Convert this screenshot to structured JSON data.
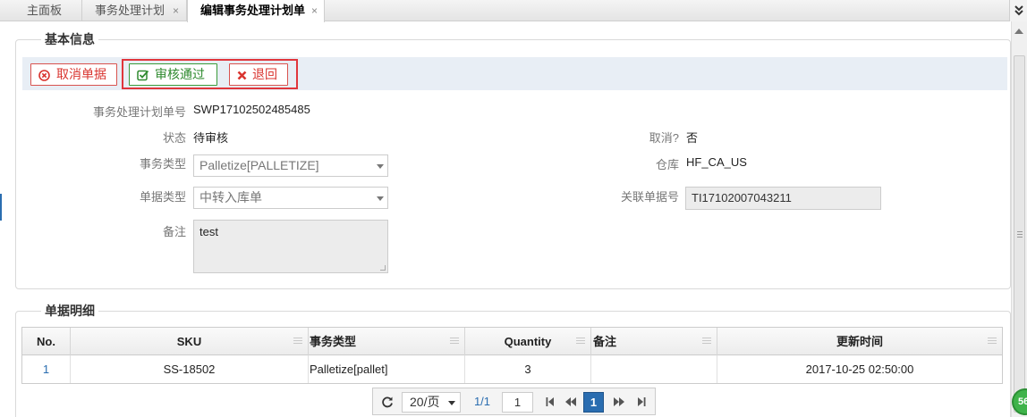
{
  "tabs": [
    {
      "label": "主面板"
    },
    {
      "label": "事务处理计划",
      "close": "×"
    },
    {
      "label": "编辑事务处理计划单",
      "close": "×"
    }
  ],
  "tab_menu_icon": "double-chevron-down-icon",
  "basic_info": {
    "legend": "基本信息",
    "toolbar": {
      "cancel_doc": "取消单据",
      "approve": "审核通过",
      "return": "退回"
    },
    "fields": {
      "plan_no_label": "事务处理计划单号",
      "plan_no": "SWP17102502485485",
      "status_label": "状态",
      "status": "待审核",
      "cancelled_label": "取消?",
      "cancelled": "否",
      "tx_type_label": "事务类型",
      "tx_type": "Palletize[PALLETIZE]",
      "warehouse_label": "仓库",
      "warehouse": "HF_CA_US",
      "doc_type_label": "单据类型",
      "doc_type": "中转入库单",
      "related_doc_label": "关联单据号",
      "related_doc": "TI17102007043211",
      "remark_label": "备注",
      "remark": "test"
    }
  },
  "details": {
    "legend": "单据明细",
    "columns": [
      "No.",
      "SKU",
      "事务类型",
      "Quantity",
      "备注",
      "更新时间"
    ],
    "rows": [
      {
        "no": "1",
        "sku": "SS-18502",
        "tx_type": "Palletize[pallet]",
        "quantity": "3",
        "remark": "",
        "updated": "2017-10-25 02:50:00"
      }
    ]
  },
  "pager": {
    "page_size": "20/页",
    "page_info": "1/1",
    "page_input": "1",
    "current_page": "1"
  },
  "badge": "56",
  "colors": {
    "accent": "#2a6db0",
    "danger": "#d9342f",
    "success": "#2e8a2e",
    "highlight": "#e0363c"
  }
}
